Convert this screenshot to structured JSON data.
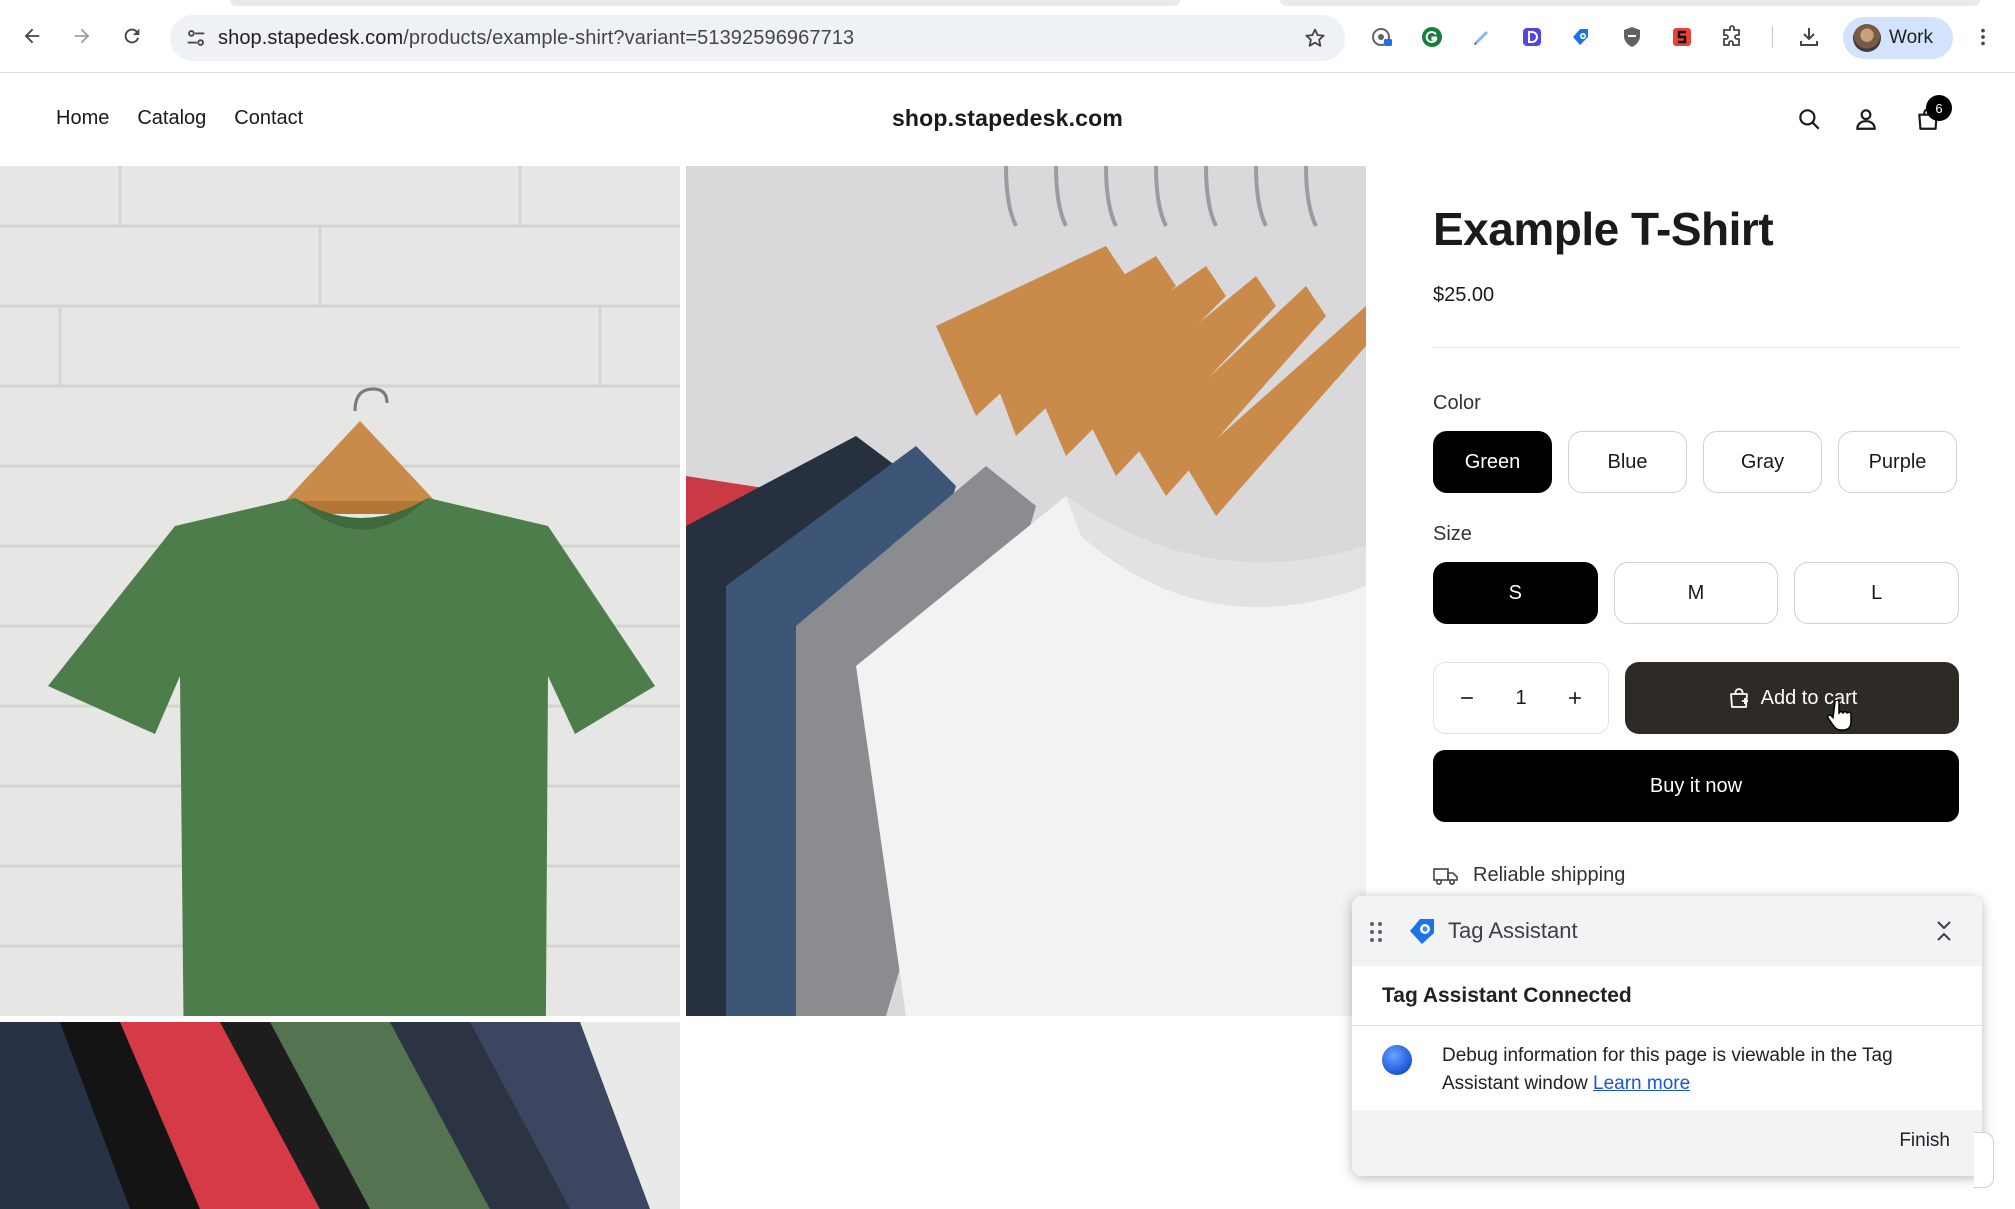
{
  "browser": {
    "url_host": "shop.stapedesk.com",
    "url_path": "/products/example-shirt?variant=51392596967713",
    "profile_label": "Work",
    "extensions": [
      "password-manager-icon",
      "grammarly-icon",
      "pen-icon",
      "d-extension-icon",
      "tag-assistant-icon",
      "shield-icon",
      "stape-icon",
      "puzzle-icon"
    ]
  },
  "store": {
    "logo": "shop.stapedesk.com",
    "nav": [
      {
        "label": "Home"
      },
      {
        "label": "Catalog"
      },
      {
        "label": "Contact"
      }
    ],
    "cart_count": "6"
  },
  "product": {
    "title": "Example T-Shirt",
    "price": "$25.00",
    "color_label": "Color",
    "colors": [
      {
        "label": "Green",
        "selected": true
      },
      {
        "label": "Blue",
        "selected": false
      },
      {
        "label": "Gray",
        "selected": false
      },
      {
        "label": "Purple",
        "selected": false
      }
    ],
    "size_label": "Size",
    "sizes": [
      {
        "label": "S",
        "selected": true
      },
      {
        "label": "M",
        "selected": false
      },
      {
        "label": "L",
        "selected": false
      }
    ],
    "quantity": "1",
    "add_to_cart": "Add to cart",
    "buy_now": "Buy it now",
    "shipping": "Reliable shipping"
  },
  "tag_assistant": {
    "title": "Tag Assistant",
    "connected": "Tag Assistant Connected",
    "message": "Debug information for this page is viewable in the Tag Assistant window",
    "learn_more": "Learn more",
    "finish": "Finish"
  },
  "colors": {
    "add_to_cart_bg": "#2e2a25",
    "buy_now_bg": "#000000",
    "selected_pill_bg": "#000000",
    "omnibox_bg": "#eef1f6",
    "profile_chip_bg": "#d3e3fd",
    "link_blue": "#1a56d6"
  }
}
